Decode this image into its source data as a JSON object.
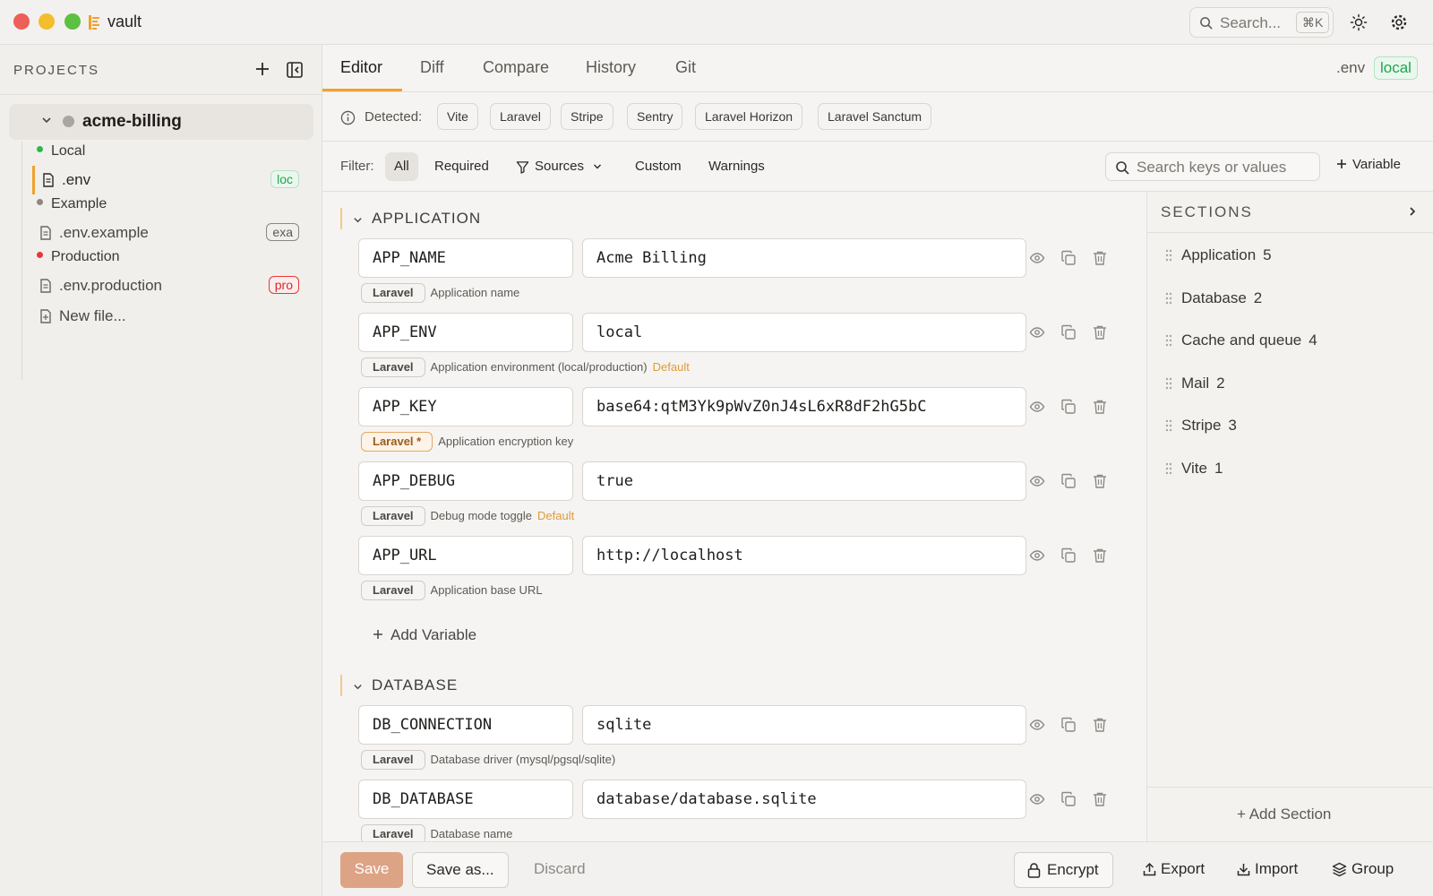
{
  "app": {
    "name": "vault"
  },
  "search": {
    "label": "Search...",
    "shortcut": "⌘K"
  },
  "sidebar": {
    "title": "PROJECTS",
    "project": {
      "name": "acme-billing"
    },
    "groups": [
      {
        "label": "Local",
        "color": "#2db84d",
        "file": ".env",
        "badge": "loc",
        "badge_style": "green"
      },
      {
        "label": "Example",
        "color": "#8a8783",
        "file": ".env.example",
        "badge": "exa",
        "badge_style": "gray"
      },
      {
        "label": "Production",
        "color": "#e5383b",
        "file": ".env.production",
        "badge": "pro",
        "badge_style": "red"
      }
    ],
    "new_file": "New file..."
  },
  "tabs": [
    "Editor",
    "Diff",
    "Compare",
    "History",
    "Git"
  ],
  "active_tab": "Editor",
  "env": {
    "file": ".env",
    "badge": "local"
  },
  "detected": {
    "label": "Detected:",
    "chips": [
      "Vite",
      "Laravel",
      "Stripe",
      "Sentry",
      "Laravel Horizon",
      "Laravel Sanctum"
    ]
  },
  "filter": {
    "label": "Filter:",
    "options": [
      "All",
      "Required",
      "Sources",
      "Custom",
      "Warnings"
    ],
    "active": "All",
    "search_placeholder": "Search keys or values",
    "add_variable": "Variable"
  },
  "sections": [
    {
      "name": "APPLICATION",
      "variables": [
        {
          "key": "APP_NAME",
          "value": "Acme Billing",
          "source": "Laravel",
          "required": false,
          "description": "Application name",
          "default": ""
        },
        {
          "key": "APP_ENV",
          "value": "local",
          "source": "Laravel",
          "required": false,
          "description": "Application environment (local/production)",
          "default": "Default"
        },
        {
          "key": "APP_KEY",
          "value": "base64:qtM3Yk9pWvZ0nJ4sL6xR8dF2hG5bC",
          "source": "Laravel *",
          "required": true,
          "description": "Application encryption key",
          "default": ""
        },
        {
          "key": "APP_DEBUG",
          "value": "true",
          "source": "Laravel",
          "required": false,
          "description": "Debug mode toggle",
          "default": "Default"
        },
        {
          "key": "APP_URL",
          "value": "http://localhost",
          "source": "Laravel",
          "required": false,
          "description": "Application base URL",
          "default": ""
        }
      ],
      "add_label": "Add Variable"
    },
    {
      "name": "DATABASE",
      "variables": [
        {
          "key": "DB_CONNECTION",
          "value": "sqlite",
          "source": "Laravel",
          "required": false,
          "description": "Database driver (mysql/pgsql/sqlite)",
          "default": ""
        },
        {
          "key": "DB_DATABASE",
          "value": "database/database.sqlite",
          "source": "Laravel",
          "required": false,
          "description": "Database name",
          "default": ""
        }
      ]
    }
  ],
  "sections_panel": {
    "title": "SECTIONS",
    "items": [
      {
        "name": "Application",
        "count": "5"
      },
      {
        "name": "Database",
        "count": "2"
      },
      {
        "name": "Cache and queue",
        "count": "4"
      },
      {
        "name": "Mail",
        "count": "2"
      },
      {
        "name": "Stripe",
        "count": "3"
      },
      {
        "name": "Vite",
        "count": "1"
      }
    ],
    "add_section": "+ Add Section"
  },
  "footer": {
    "save": "Save",
    "save_as": "Save as...",
    "discard": "Discard",
    "encrypt": "Encrypt",
    "export": "Export",
    "import": "Import",
    "group": "Group"
  },
  "colors": {
    "accent": "#f0a030",
    "save_button": "#dca385",
    "env_green": "#1fa64b"
  }
}
